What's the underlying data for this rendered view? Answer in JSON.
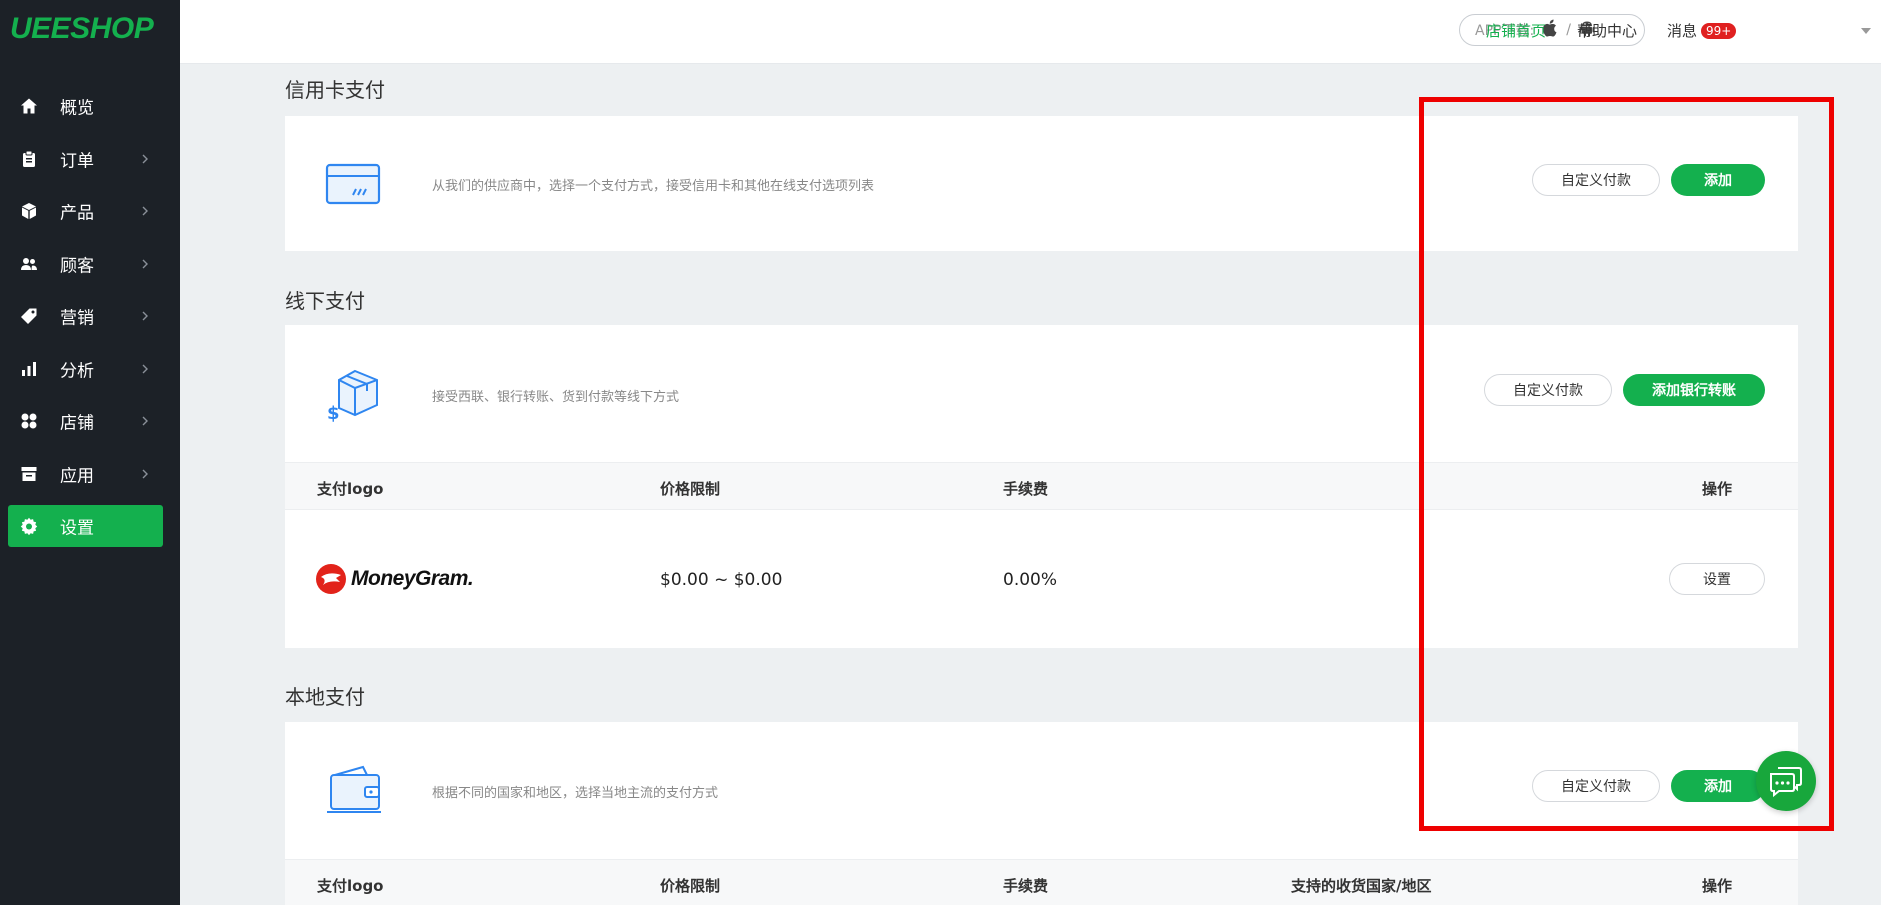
{
  "brand": {
    "logo_text": "UEESHOP",
    "accent": "#14b04e",
    "sidebar_bg": "#1c2127"
  },
  "sidebar": {
    "items": [
      {
        "label": "概览",
        "icon": "home-icon",
        "has_arrow": false,
        "active": false
      },
      {
        "label": "订单",
        "icon": "clipboard-icon",
        "has_arrow": true,
        "active": false
      },
      {
        "label": "产品",
        "icon": "box-icon",
        "has_arrow": true,
        "active": false
      },
      {
        "label": "顾客",
        "icon": "users-icon",
        "has_arrow": true,
        "active": false
      },
      {
        "label": "营销",
        "icon": "tag-icon",
        "has_arrow": true,
        "active": false
      },
      {
        "label": "分析",
        "icon": "bar-chart-icon",
        "has_arrow": true,
        "active": false
      },
      {
        "label": "店铺",
        "icon": "grid-icon",
        "has_arrow": true,
        "active": false
      },
      {
        "label": "应用",
        "icon": "store-icon",
        "has_arrow": true,
        "active": false
      },
      {
        "label": "设置",
        "icon": "gear-icon",
        "has_arrow": false,
        "active": true
      }
    ]
  },
  "topbar": {
    "app_download_label": "APP下载:",
    "app_separator": "/",
    "store_home": "店铺首页",
    "help_center": "帮助中心",
    "messages_label": "消息",
    "messages_badge": "99+"
  },
  "sections": {
    "credit_card": {
      "title": "信用卡支付",
      "description": "从我们的供应商中，选择一个支付方式，接受信用卡和其他在线支付选项列表",
      "custom_button": "自定义付款",
      "add_button": "添加"
    },
    "offline": {
      "title": "线下支付",
      "description": "接受西联、银行转账、货到付款等线下方式",
      "custom_button": "自定义付款",
      "add_button": "添加银行转账",
      "table": {
        "headers": {
          "logo": "支付logo",
          "price_limit": "价格限制",
          "fee": "手续费",
          "action": "操作"
        },
        "rows": [
          {
            "logo_text": "MoneyGram.",
            "price_limit": "$0.00 ~ $0.00",
            "fee": "0.00%",
            "action": "设置"
          }
        ]
      }
    },
    "local": {
      "title": "本地支付",
      "description": "根据不同的国家和地区，选择当地主流的支付方式",
      "custom_button": "自定义付款",
      "add_button": "添加",
      "table": {
        "headers": {
          "logo": "支付logo",
          "price_limit": "价格限制",
          "fee": "手续费",
          "countries": "支持的收货国家/地区",
          "action": "操作"
        }
      }
    }
  },
  "highlight_box_color": "#ee0000"
}
